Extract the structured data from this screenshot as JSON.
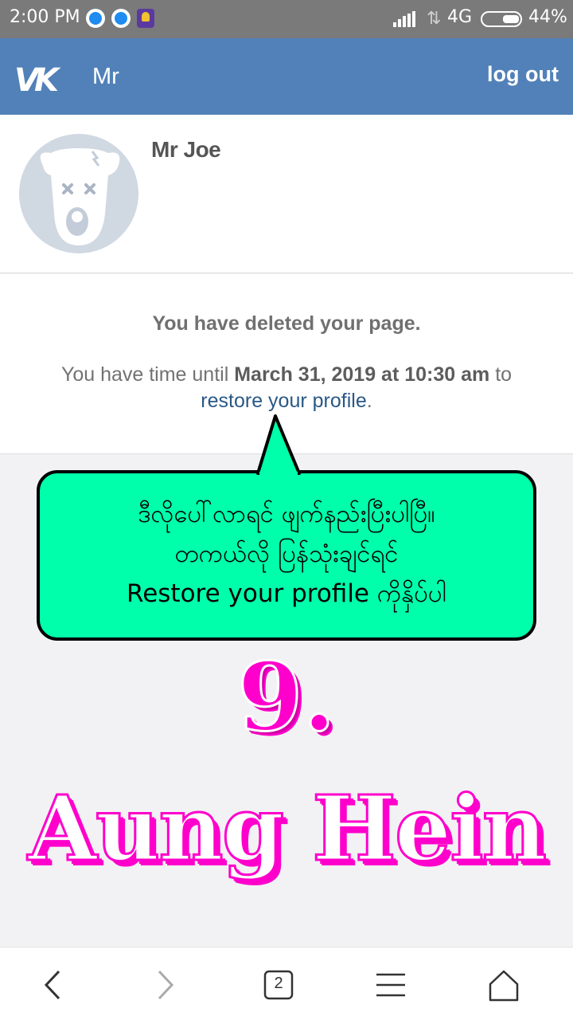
{
  "status_bar": {
    "time": "2:00 PM",
    "network": "4G",
    "battery": "44%",
    "battery_level": 0.44,
    "icons": [
      "messenger-icon",
      "messenger-icon",
      "app-icon",
      "signal-icon",
      "data-arrows-icon",
      "battery-icon"
    ]
  },
  "header": {
    "logo": "VK",
    "title": "Mr",
    "logout_label": "log out",
    "background": "#5181b8"
  },
  "profile": {
    "name": "Mr Joe",
    "avatar_icon": "deleted-dog-avatar-icon"
  },
  "notice": {
    "heading": "You have deleted your page.",
    "text_before": "You have time until ",
    "deadline": "March 31, 2019 at 10:30 am",
    "text_after": " to",
    "link": "restore your profile",
    "period": "."
  },
  "callout": {
    "lines": [
      "ဒီလိုပေါ်လာရင် ဖျက်နည်းပြီးပါပြီ။",
      "တကယ်လို ပြန်သုံးချင်ရင်",
      "Restore your profile ကိုနှိပ်ပါ"
    ],
    "background": "#00ffaa"
  },
  "overlay": {
    "step": "9.",
    "author": "Aung Hein",
    "color": "#ff00cc"
  },
  "bottom_nav": {
    "tab_count": "2",
    "buttons": [
      "back-icon",
      "forward-icon",
      "tabs-icon",
      "menu-icon",
      "home-icon"
    ]
  }
}
